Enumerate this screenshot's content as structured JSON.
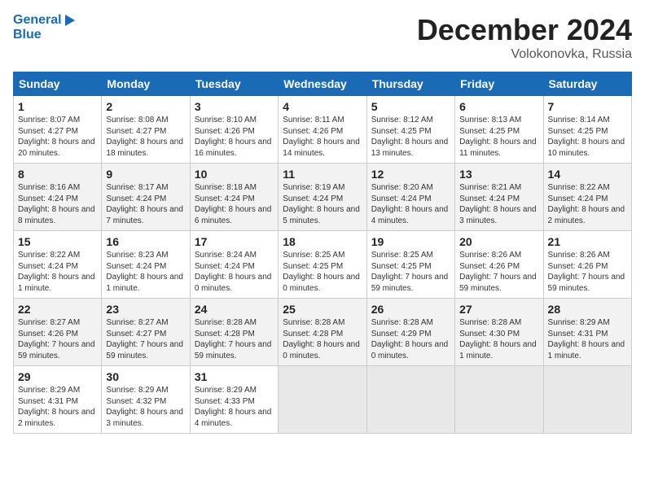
{
  "header": {
    "logo_line1": "General",
    "logo_line2": "Blue",
    "month_title": "December 2024",
    "location": "Volokonovka, Russia"
  },
  "days_of_week": [
    "Sunday",
    "Monday",
    "Tuesday",
    "Wednesday",
    "Thursday",
    "Friday",
    "Saturday"
  ],
  "weeks": [
    [
      {
        "day": 1,
        "rise": "8:07 AM",
        "set": "4:27 PM",
        "daylight": "8 hours and 20 minutes."
      },
      {
        "day": 2,
        "rise": "8:08 AM",
        "set": "4:27 PM",
        "daylight": "8 hours and 18 minutes."
      },
      {
        "day": 3,
        "rise": "8:10 AM",
        "set": "4:26 PM",
        "daylight": "8 hours and 16 minutes."
      },
      {
        "day": 4,
        "rise": "8:11 AM",
        "set": "4:26 PM",
        "daylight": "8 hours and 14 minutes."
      },
      {
        "day": 5,
        "rise": "8:12 AM",
        "set": "4:25 PM",
        "daylight": "8 hours and 13 minutes."
      },
      {
        "day": 6,
        "rise": "8:13 AM",
        "set": "4:25 PM",
        "daylight": "8 hours and 11 minutes."
      },
      {
        "day": 7,
        "rise": "8:14 AM",
        "set": "4:25 PM",
        "daylight": "8 hours and 10 minutes."
      }
    ],
    [
      {
        "day": 8,
        "rise": "8:16 AM",
        "set": "4:24 PM",
        "daylight": "8 hours and 8 minutes."
      },
      {
        "day": 9,
        "rise": "8:17 AM",
        "set": "4:24 PM",
        "daylight": "8 hours and 7 minutes."
      },
      {
        "day": 10,
        "rise": "8:18 AM",
        "set": "4:24 PM",
        "daylight": "8 hours and 6 minutes."
      },
      {
        "day": 11,
        "rise": "8:19 AM",
        "set": "4:24 PM",
        "daylight": "8 hours and 5 minutes."
      },
      {
        "day": 12,
        "rise": "8:20 AM",
        "set": "4:24 PM",
        "daylight": "8 hours and 4 minutes."
      },
      {
        "day": 13,
        "rise": "8:21 AM",
        "set": "4:24 PM",
        "daylight": "8 hours and 3 minutes."
      },
      {
        "day": 14,
        "rise": "8:22 AM",
        "set": "4:24 PM",
        "daylight": "8 hours and 2 minutes."
      }
    ],
    [
      {
        "day": 15,
        "rise": "8:22 AM",
        "set": "4:24 PM",
        "daylight": "8 hours and 1 minute."
      },
      {
        "day": 16,
        "rise": "8:23 AM",
        "set": "4:24 PM",
        "daylight": "8 hours and 1 minute."
      },
      {
        "day": 17,
        "rise": "8:24 AM",
        "set": "4:24 PM",
        "daylight": "8 hours and 0 minutes."
      },
      {
        "day": 18,
        "rise": "8:25 AM",
        "set": "4:25 PM",
        "daylight": "8 hours and 0 minutes."
      },
      {
        "day": 19,
        "rise": "8:25 AM",
        "set": "4:25 PM",
        "daylight": "7 hours and 59 minutes."
      },
      {
        "day": 20,
        "rise": "8:26 AM",
        "set": "4:26 PM",
        "daylight": "7 hours and 59 minutes."
      },
      {
        "day": 21,
        "rise": "8:26 AM",
        "set": "4:26 PM",
        "daylight": "7 hours and 59 minutes."
      }
    ],
    [
      {
        "day": 22,
        "rise": "8:27 AM",
        "set": "4:26 PM",
        "daylight": "7 hours and 59 minutes."
      },
      {
        "day": 23,
        "rise": "8:27 AM",
        "set": "4:27 PM",
        "daylight": "7 hours and 59 minutes."
      },
      {
        "day": 24,
        "rise": "8:28 AM",
        "set": "4:28 PM",
        "daylight": "7 hours and 59 minutes."
      },
      {
        "day": 25,
        "rise": "8:28 AM",
        "set": "4:28 PM",
        "daylight": "8 hours and 0 minutes."
      },
      {
        "day": 26,
        "rise": "8:28 AM",
        "set": "4:29 PM",
        "daylight": "8 hours and 0 minutes."
      },
      {
        "day": 27,
        "rise": "8:28 AM",
        "set": "4:30 PM",
        "daylight": "8 hours and 1 minute."
      },
      {
        "day": 28,
        "rise": "8:29 AM",
        "set": "4:31 PM",
        "daylight": "8 hours and 1 minute."
      }
    ],
    [
      {
        "day": 29,
        "rise": "8:29 AM",
        "set": "4:31 PM",
        "daylight": "8 hours and 2 minutes."
      },
      {
        "day": 30,
        "rise": "8:29 AM",
        "set": "4:32 PM",
        "daylight": "8 hours and 3 minutes."
      },
      {
        "day": 31,
        "rise": "8:29 AM",
        "set": "4:33 PM",
        "daylight": "8 hours and 4 minutes."
      },
      null,
      null,
      null,
      null
    ]
  ]
}
